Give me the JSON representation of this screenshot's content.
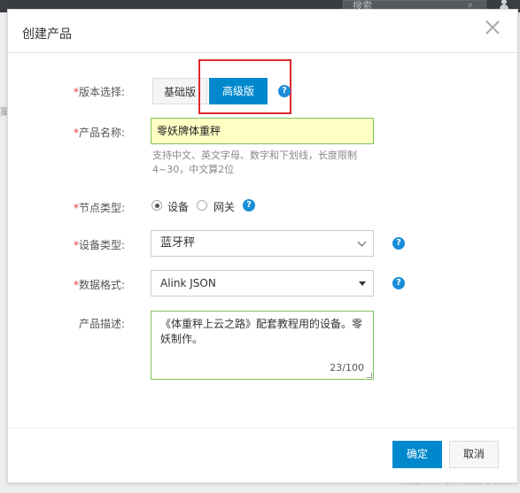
{
  "background": {
    "search_placeholder": "搜索",
    "side_text": "案",
    "watermark": "微信公众号：物联网零妖"
  },
  "dialog": {
    "title": "创建产品",
    "fields": {
      "version": {
        "label": "版本选择:",
        "options": [
          "基础版",
          "高级版"
        ],
        "selected": "高级版"
      },
      "product_name": {
        "label": "产品名称:",
        "value": "零妖牌体重秤",
        "hint": "支持中文、英文字母、数字和下划线，长度限制4~30，中文算2位"
      },
      "node_type": {
        "label": "节点类型:",
        "options": [
          "设备",
          "网关"
        ],
        "selected": "设备"
      },
      "device_type": {
        "label": "设备类型:",
        "value": "蓝牙秤"
      },
      "data_format": {
        "label": "数据格式:",
        "value": "Alink JSON"
      },
      "description": {
        "label": "产品描述:",
        "value": "《体重秤上云之路》配套教程用的设备。零妖制作。",
        "counter": "23/100"
      }
    },
    "buttons": {
      "ok": "确定",
      "cancel": "取消"
    }
  },
  "colors": {
    "primary": "#0088cc",
    "required_mark": "#e4393c",
    "highlight_border": "#e0262b",
    "valid_border": "#7fc35b",
    "input_filled_bg": "#ffffc4"
  },
  "help_icon_glyph": "?",
  "required_mark": "*"
}
